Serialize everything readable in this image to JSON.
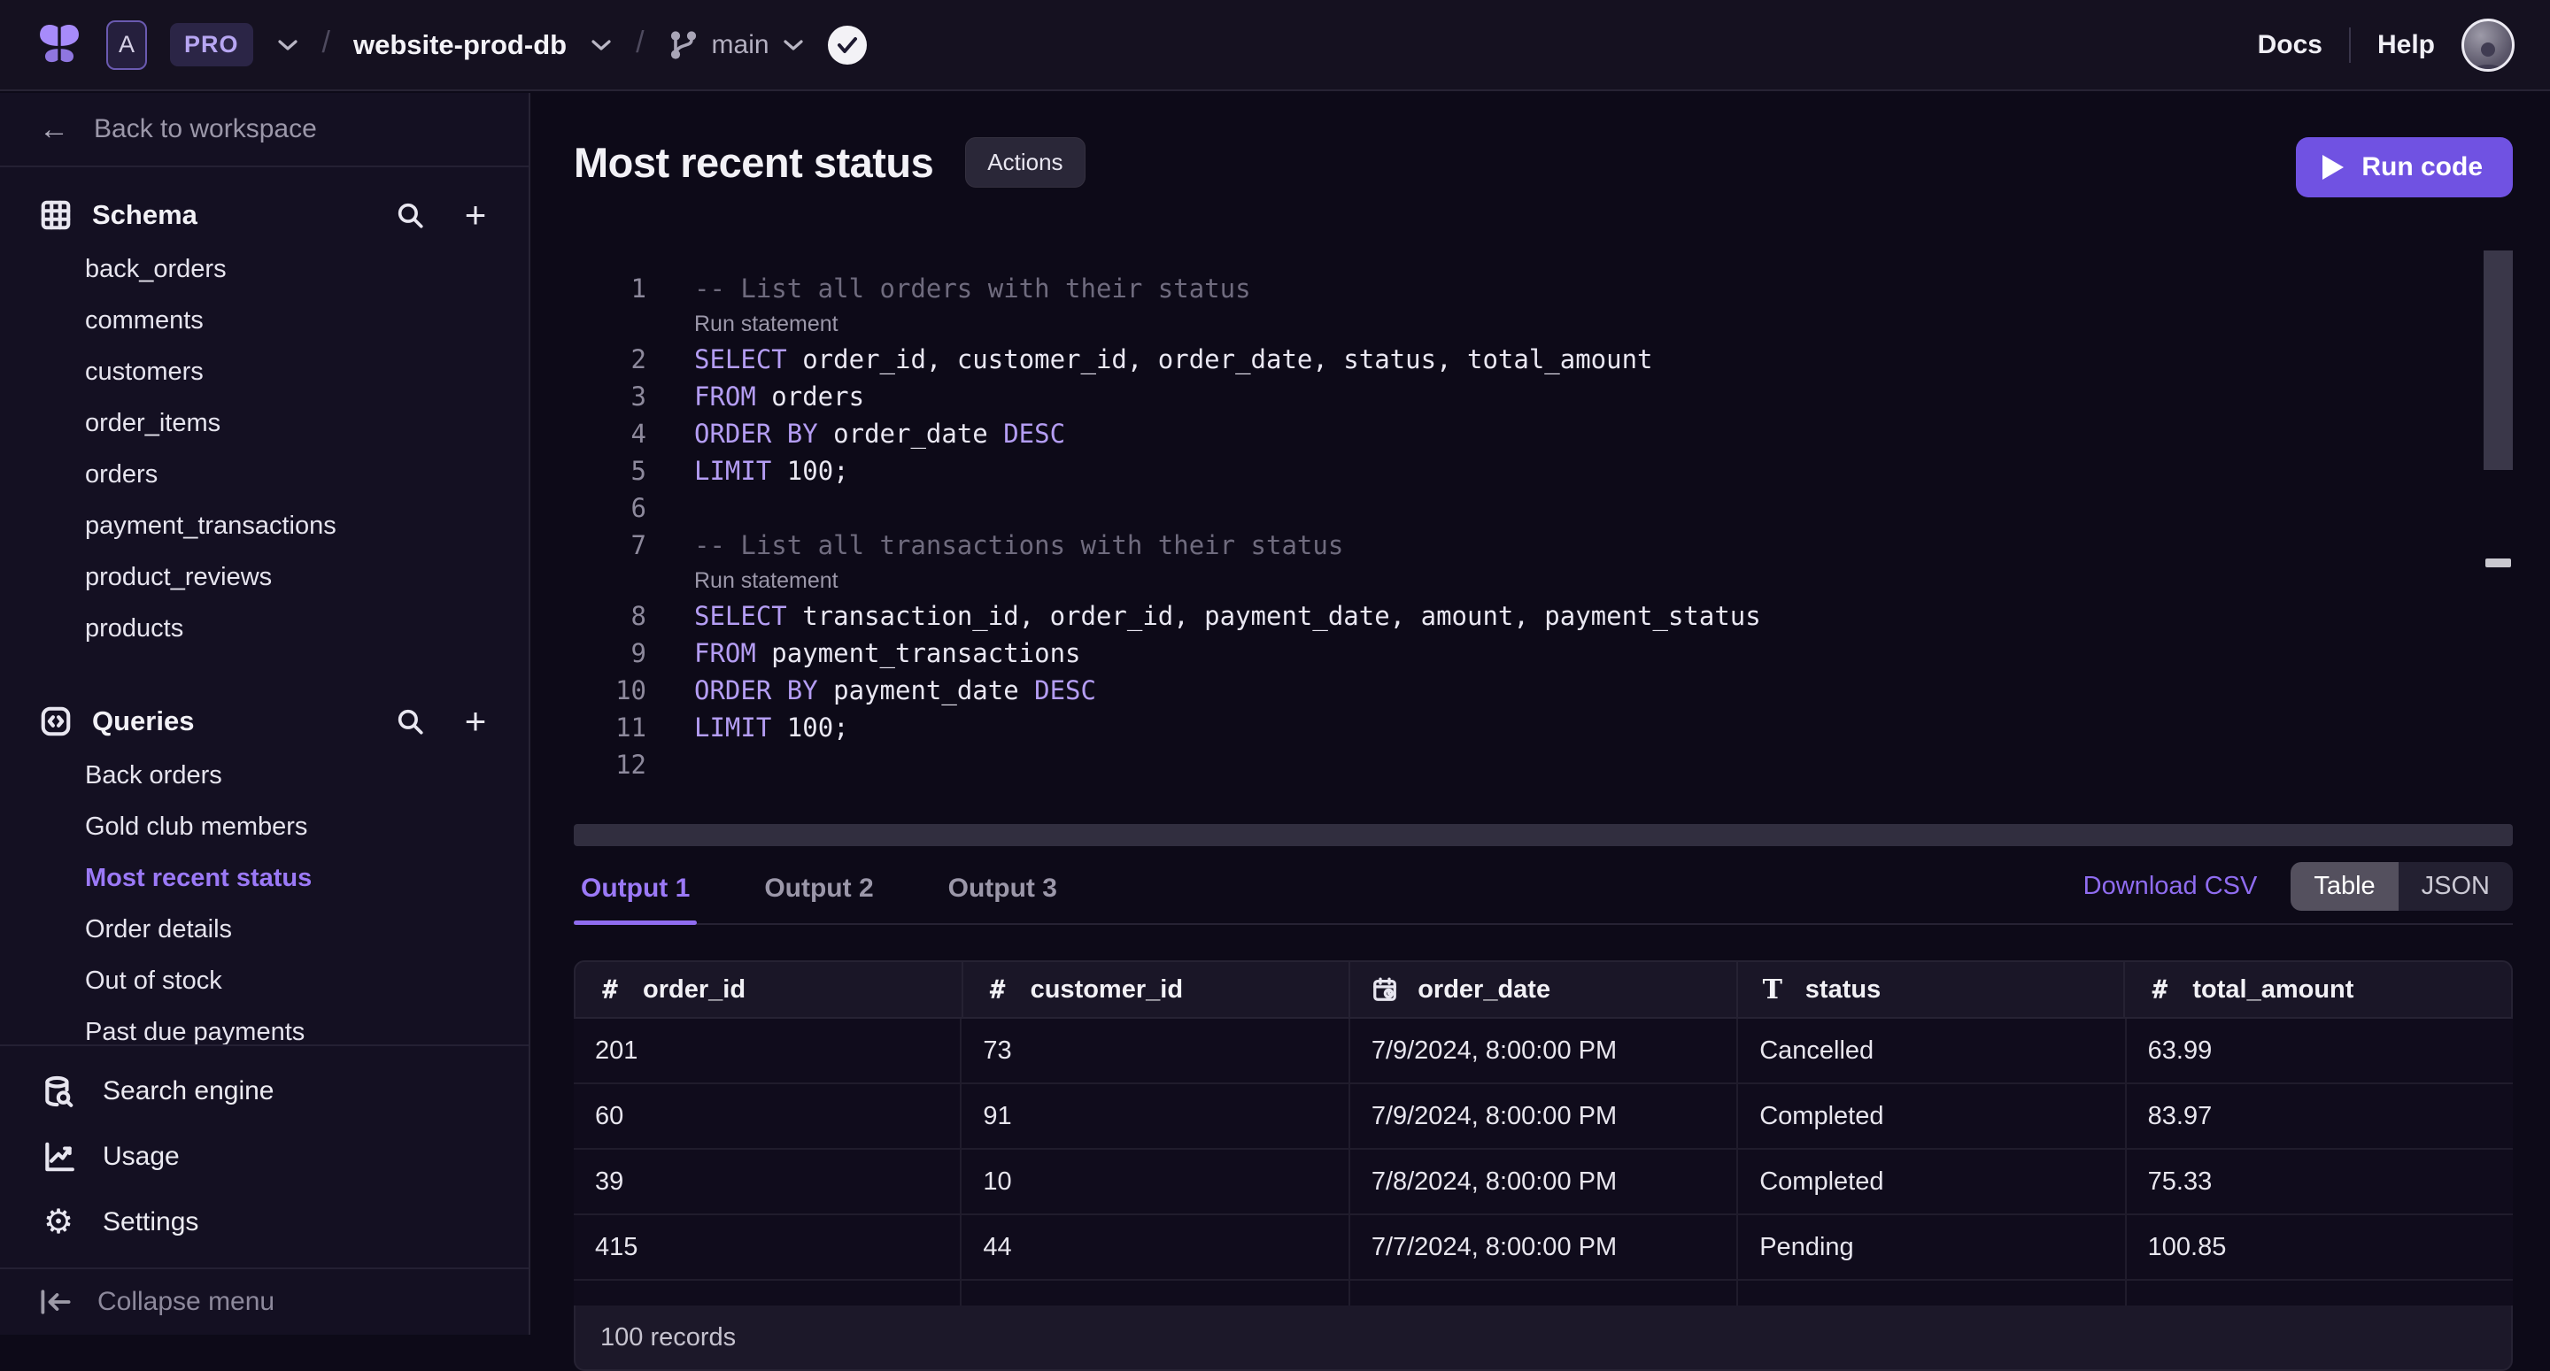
{
  "header": {
    "workspace_initial": "A",
    "plan": "PRO",
    "separator": "/",
    "database": "website-prod-db",
    "branch": "main",
    "docs": "Docs",
    "help": "Help"
  },
  "sidebar": {
    "back_label": "Back to workspace",
    "schema_title": "Schema",
    "schema_items": [
      "back_orders",
      "comments",
      "customers",
      "order_items",
      "orders",
      "payment_transactions",
      "product_reviews",
      "products"
    ],
    "queries_title": "Queries",
    "query_items": [
      "Back orders",
      "Gold club members",
      "Most recent status",
      "Order details",
      "Out of stock",
      "Past due payments"
    ],
    "active_query": "Most recent status",
    "tools": [
      {
        "label": "Search engine",
        "icon": "database-search-icon"
      },
      {
        "label": "Usage",
        "icon": "chart-icon"
      },
      {
        "label": "Settings",
        "icon": "gear-icon"
      }
    ],
    "collapse_label": "Collapse menu"
  },
  "main": {
    "title": "Most recent status",
    "actions_label": "Actions",
    "run_code_label": "Run code",
    "editor": {
      "run_statement_label": "Run statement",
      "lines": [
        {
          "n": "1",
          "segs": [
            [
              "com",
              "-- List all orders with their status"
            ]
          ],
          "run_after": true
        },
        {
          "n": "2",
          "segs": [
            [
              "kw",
              "SELECT"
            ],
            [
              "pl",
              " order_id, customer_id, order_date, status, total_amount"
            ]
          ]
        },
        {
          "n": "3",
          "segs": [
            [
              "kw",
              "FROM"
            ],
            [
              "pl",
              " orders"
            ]
          ]
        },
        {
          "n": "4",
          "segs": [
            [
              "kw",
              "ORDER BY"
            ],
            [
              "pl",
              " order_date "
            ],
            [
              "kw",
              "DESC"
            ]
          ]
        },
        {
          "n": "5",
          "segs": [
            [
              "kw",
              "LIMIT"
            ],
            [
              "pl",
              " 100;"
            ]
          ]
        },
        {
          "n": "6",
          "segs": []
        },
        {
          "n": "7",
          "segs": [
            [
              "com",
              "-- List all transactions with their status"
            ]
          ],
          "run_after": true
        },
        {
          "n": "8",
          "segs": [
            [
              "kw",
              "SELECT"
            ],
            [
              "pl",
              " transaction_id, order_id, payment_date, amount, payment_status"
            ]
          ]
        },
        {
          "n": "9",
          "segs": [
            [
              "kw",
              "FROM"
            ],
            [
              "pl",
              " payment_transactions"
            ]
          ]
        },
        {
          "n": "10",
          "segs": [
            [
              "kw",
              "ORDER BY"
            ],
            [
              "pl",
              " payment_date "
            ],
            [
              "kw",
              "DESC"
            ]
          ]
        },
        {
          "n": "11",
          "segs": [
            [
              "kw",
              "LIMIT"
            ],
            [
              "pl",
              " 100;"
            ]
          ]
        },
        {
          "n": "12",
          "segs": []
        }
      ]
    },
    "output": {
      "tabs": [
        "Output 1",
        "Output 2",
        "Output 3"
      ],
      "active_tab": "Output 1",
      "download_csv": "Download CSV",
      "views": [
        "Table",
        "JSON"
      ],
      "active_view": "Table",
      "table": {
        "columns": [
          {
            "name": "order_id",
            "type": "number"
          },
          {
            "name": "customer_id",
            "type": "number"
          },
          {
            "name": "order_date",
            "type": "date"
          },
          {
            "name": "status",
            "type": "text"
          },
          {
            "name": "total_amount",
            "type": "number"
          }
        ],
        "rows": [
          [
            "201",
            "73",
            "7/9/2024, 8:00:00 PM",
            "Cancelled",
            "63.99"
          ],
          [
            "60",
            "91",
            "7/9/2024, 8:00:00 PM",
            "Completed",
            "83.97"
          ],
          [
            "39",
            "10",
            "7/8/2024, 8:00:00 PM",
            "Completed",
            "75.33"
          ],
          [
            "415",
            "44",
            "7/7/2024, 8:00:00 PM",
            "Pending",
            "100.85"
          ]
        ],
        "records_label": "100 records"
      }
    }
  },
  "colors": {
    "accent": "#8f6cf0",
    "run_button": "#7052e2",
    "keyword": "#b49df3",
    "comment": "#6f6b7e",
    "background": "#0d0a18",
    "panel": "#151120",
    "logo": "#a78bfa"
  }
}
